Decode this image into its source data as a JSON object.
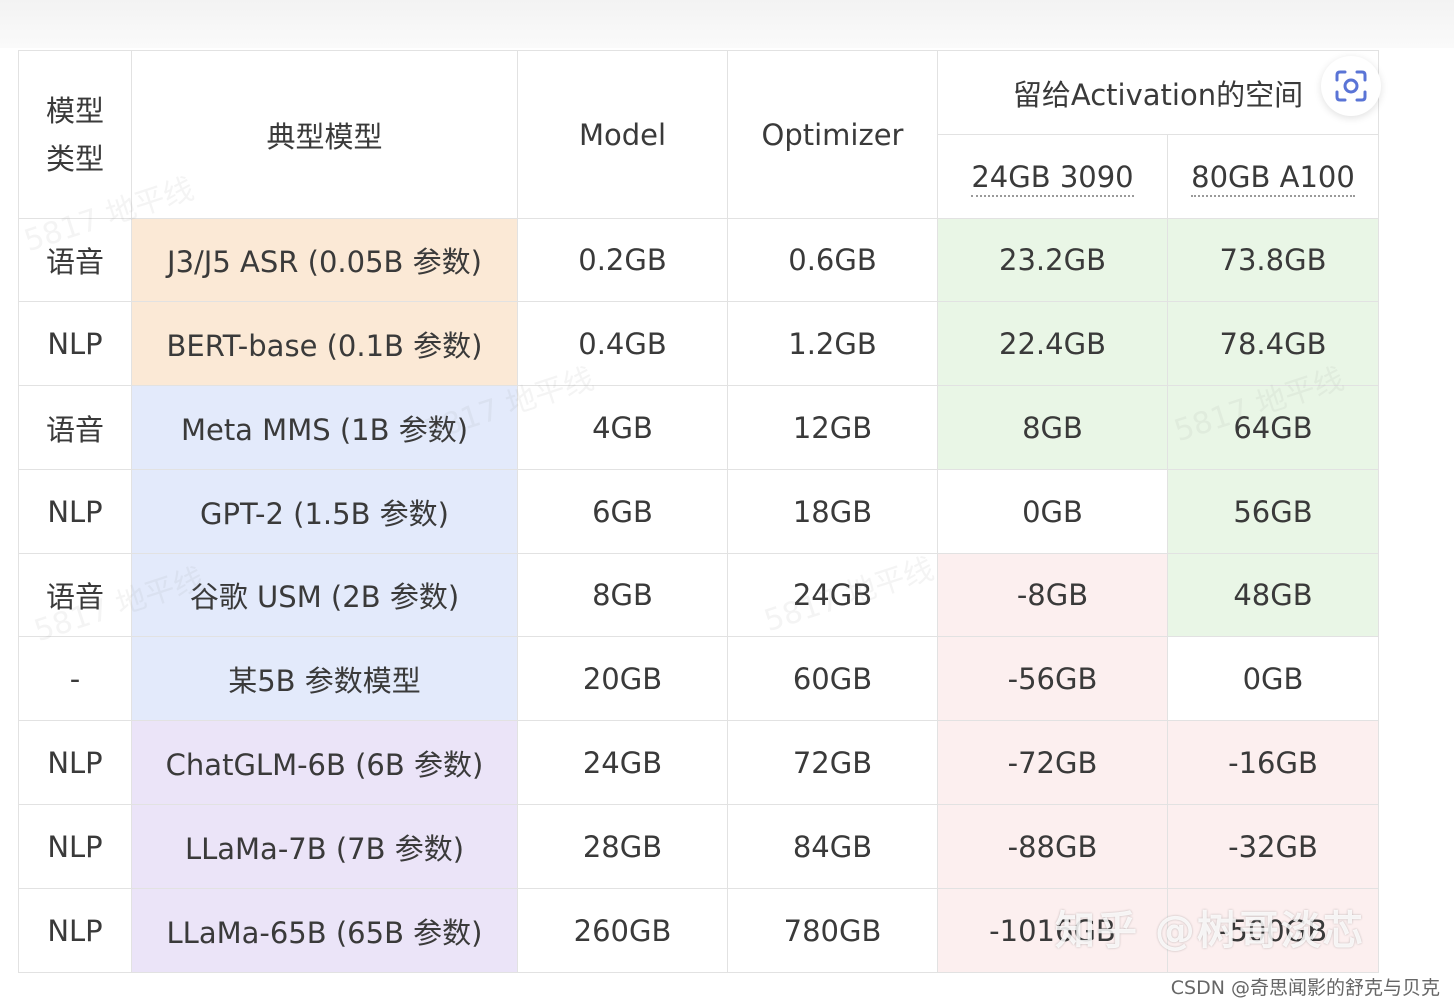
{
  "table": {
    "headers": {
      "type": [
        "模型",
        "类型"
      ],
      "typical": "典型模型",
      "model": "Model",
      "optimizer": "Optimizer",
      "activation": "留给Activation的空间",
      "gpu_3090": "24GB 3090",
      "gpu_a100": "80GB A100"
    },
    "rows": [
      {
        "type": "语音",
        "name": "J3/J5 ASR (0.05B 参数)",
        "model": "0.2GB",
        "optimizer": "0.6GB",
        "act3090": "23.2GB",
        "acta100": "73.8GB"
      },
      {
        "type": "NLP",
        "name": "BERT-base (0.1B 参数)",
        "model": "0.4GB",
        "optimizer": "1.2GB",
        "act3090": "22.4GB",
        "acta100": "78.4GB"
      },
      {
        "type": "语音",
        "name": "Meta MMS (1B 参数)",
        "model": "4GB",
        "optimizer": "12GB",
        "act3090": "8GB",
        "acta100": "64GB"
      },
      {
        "type": "NLP",
        "name": "GPT-2 (1.5B 参数)",
        "model": "6GB",
        "optimizer": "18GB",
        "act3090": "0GB",
        "acta100": "56GB"
      },
      {
        "type": "语音",
        "name": "谷歌 USM (2B 参数)",
        "model": "8GB",
        "optimizer": "24GB",
        "act3090": "-8GB",
        "acta100": "48GB"
      },
      {
        "type": "-",
        "name": "某5B 参数模型",
        "model": "20GB",
        "optimizer": "60GB",
        "act3090": "-56GB",
        "acta100": "0GB"
      },
      {
        "type": "NLP",
        "name": "ChatGLM-6B (6B 参数)",
        "model": "24GB",
        "optimizer": "72GB",
        "act3090": "-72GB",
        "acta100": "-16GB"
      },
      {
        "type": "NLP",
        "name": "LLaMa-7B (7B 参数)",
        "model": "28GB",
        "optimizer": "84GB",
        "act3090": "-88GB",
        "acta100": "-32GB"
      },
      {
        "type": "NLP",
        "name": "LLaMa-65B (65B 参数)",
        "model": "260GB",
        "optimizer": "780GB",
        "act3090": "-1016GB",
        "acta100": "-500GB"
      }
    ]
  },
  "colors": {
    "orange": "#fbe9d6",
    "blue": "#e3eafb",
    "purple": "#ebe4f8",
    "green": "#e9f6e6",
    "red": "#fcefef"
  },
  "icons": {
    "scan": "scan-icon"
  },
  "watermarks": {
    "main": "知乎 @树哥淡芯",
    "credit": "CSDN @奇思闻影的舒克与贝克"
  }
}
